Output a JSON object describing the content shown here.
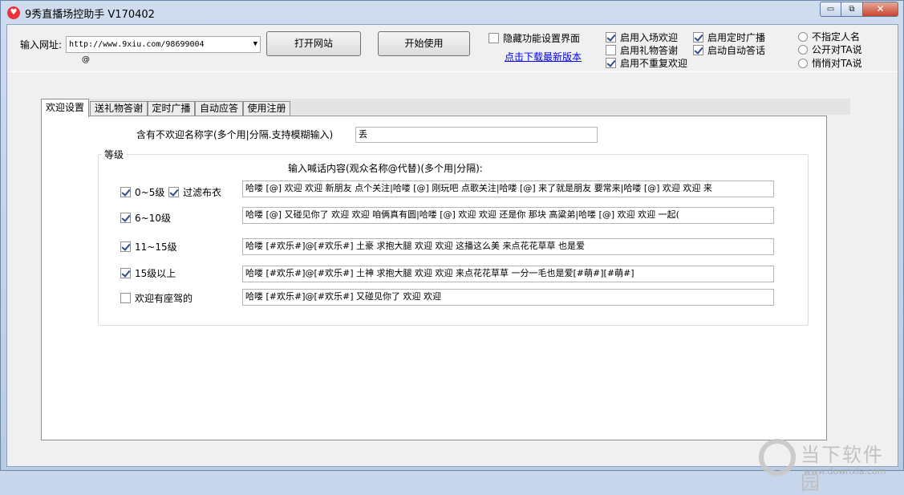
{
  "window": {
    "title": "9秀直播场控助手 V170402",
    "controls": {
      "minimize": "▭",
      "restore": "⧉",
      "close": "✕"
    }
  },
  "toolbar": {
    "url_label": "输入网址:",
    "url_value": "http://www.9xiu.com/98699004",
    "at_symbol": "@",
    "open_site_button": "打开网站",
    "start_button": "开始使用",
    "hide_settings": {
      "label": "隐藏功能设置界面",
      "checked": false
    },
    "download_link": "点击下载最新版本",
    "checks": [
      {
        "label": "启用入场欢迎",
        "checked": true
      },
      {
        "label": "启用礼物答谢",
        "checked": false
      },
      {
        "label": "启用不重复欢迎",
        "checked": true
      },
      {
        "label": "启用定时广播",
        "checked": true
      },
      {
        "label": "启动自动答话",
        "checked": true
      }
    ],
    "radios": [
      {
        "label": "不指定人名",
        "selected": false
      },
      {
        "label": "公开对TA说",
        "selected": false
      },
      {
        "label": "悄悄对TA说",
        "selected": false
      }
    ]
  },
  "tabs": [
    {
      "label": "欢迎设置",
      "active": true
    },
    {
      "label": "送礼物答谢",
      "active": false
    },
    {
      "label": "定时广播",
      "active": false
    },
    {
      "label": "自动应答",
      "active": false
    },
    {
      "label": "使用注册",
      "active": false
    }
  ],
  "welcome": {
    "exclude_label": "含有不欢迎名称字(多个用|分隔.支持模糊输入)",
    "exclude_value": "丢",
    "group_title": "等级",
    "shout_label": "输入喊话内容(观众名称@代替)(多个用|分隔):",
    "filter_clothes": {
      "label": "过滤布衣",
      "checked": true
    },
    "levels": [
      {
        "label": "0~5级",
        "checked": true,
        "text": "哈喽 [@] 欢迎 欢迎 新朋友 点个关注|哈喽 [@] 刚玩吧 点歌关注|哈喽 [@] 来了就是朋友 要常来|哈喽 [@] 欢迎 欢迎 来"
      },
      {
        "label": "6~10级",
        "checked": true,
        "text": "哈喽 [@] 又碰见你了 欢迎 欢迎   咱俩真有圆|哈喽 [@]  欢迎 欢迎  还是你  那块 高粱弟|哈喽 [@]  欢迎 欢迎  一起("
      },
      {
        "label": "11~15级",
        "checked": true,
        "text": "哈喽 [#欢乐#]@[#欢乐#]  土豪 求抱大腿 欢迎 欢迎  这播这么美  来点花花草草 也是爱"
      },
      {
        "label": "15级以上",
        "checked": true,
        "text": "哈喽 [#欢乐#]@[#欢乐#] 土神 求抱大腿 欢迎 欢迎  来点花花草草  一分一毛也是爱[#萌#][#萌#]"
      },
      {
        "label": "欢迎有座驾的",
        "checked": false,
        "text": "哈喽 [#欢乐#]@[#欢乐#] 又碰见你了 欢迎 欢迎"
      }
    ]
  },
  "watermark": {
    "name": "当下软件园",
    "url": "www.downxia.com"
  }
}
